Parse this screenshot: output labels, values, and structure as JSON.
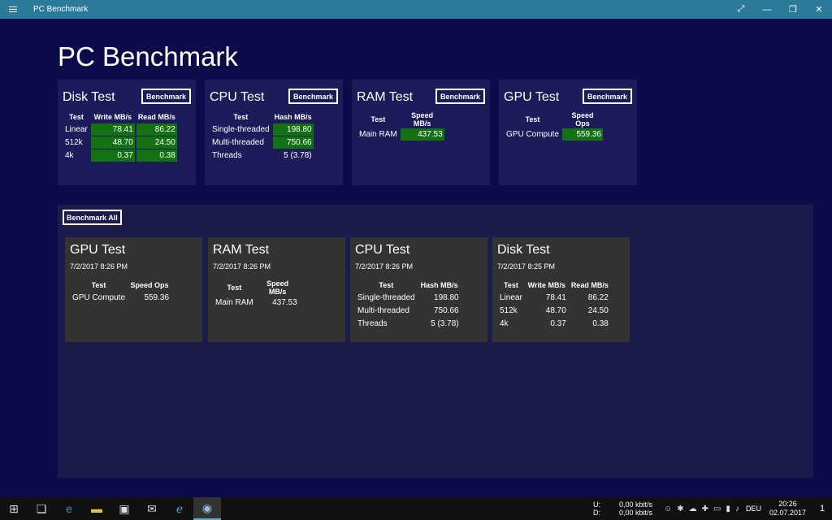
{
  "window": {
    "title": "PC Benchmark"
  },
  "app_title": "PC Benchmark",
  "cards": {
    "disk": {
      "title": "Disk Test",
      "button": "Benchmark",
      "headers": [
        "Test",
        "Write MB/s",
        "Read MB/s"
      ],
      "rows": [
        [
          "Linear",
          "78.41",
          "86.22"
        ],
        [
          "512k",
          "48.70",
          "24.50"
        ],
        [
          "4k",
          "0.37",
          "0.38"
        ]
      ]
    },
    "cpu": {
      "title": "CPU Test",
      "button": "Benchmark",
      "headers": [
        "Test",
        "Hash MB/s"
      ],
      "rows": [
        [
          "Single-threaded",
          "198.80"
        ],
        [
          "Multi-threaded",
          "750.66"
        ],
        [
          "Threads",
          "5 (3.78)"
        ]
      ]
    },
    "ram": {
      "title": "RAM Test",
      "button": "Benchmark",
      "headers": [
        "Test",
        "Speed MB/s"
      ],
      "rows": [
        [
          "Main RAM",
          "437.53"
        ]
      ]
    },
    "gpu": {
      "title": "GPU Test",
      "button": "Benchmark",
      "headers": [
        "Test",
        "Speed Ops"
      ],
      "rows": [
        [
          "GPU Compute",
          "559.36"
        ]
      ]
    }
  },
  "panel": {
    "benchmark_all": "Benchmark All",
    "results": {
      "gpu": {
        "title": "GPU Test",
        "date": "7/2/2017 8:26 PM",
        "headers": [
          "Test",
          "Speed Ops"
        ],
        "rows": [
          [
            "GPU Compute",
            "559.36"
          ]
        ]
      },
      "ram": {
        "title": "RAM Test",
        "date": "7/2/2017 8:26 PM",
        "headers": [
          "Test",
          "Speed MB/s"
        ],
        "rows": [
          [
            "Main RAM",
            "437.53"
          ]
        ]
      },
      "cpu": {
        "title": "CPU Test",
        "date": "7/2/2017 8:26 PM",
        "headers": [
          "Test",
          "Hash MB/s"
        ],
        "rows": [
          [
            "Single-threaded",
            "198.80"
          ],
          [
            "Multi-threaded",
            "750.66"
          ],
          [
            "Threads",
            "5 (3.78)"
          ]
        ]
      },
      "disk": {
        "title": "Disk Test",
        "date": "7/2/2017 8:25 PM",
        "headers": [
          "Test",
          "Write MB/s",
          "Read MB/s"
        ],
        "rows": [
          [
            "Linear",
            "78.41",
            "86.22"
          ],
          [
            "512k",
            "48.70",
            "24.50"
          ],
          [
            "4k",
            "0.37",
            "0.38"
          ]
        ]
      }
    }
  },
  "taskbar": {
    "net_up_label": "U:",
    "net_down_label": "D:",
    "net_up_value": "0,00 kbit/s",
    "net_down_value": "0,00 kbit/s",
    "language": "DEU",
    "time": "20:26",
    "date": "02.07.2017",
    "notification_count": "1"
  },
  "colors": {
    "background": "#0c0c4a",
    "card": "#1c1c5a",
    "titlebar": "#2b7a9a",
    "highlight": "#137013",
    "result_card": "#333333"
  }
}
